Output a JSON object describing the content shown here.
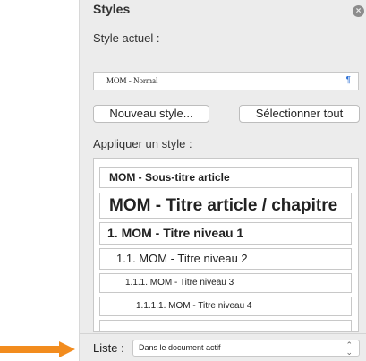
{
  "panel": {
    "title": "Styles",
    "close_icon": "close-icon",
    "current_label": "Style actuel :",
    "current_value": "MOM - Normal",
    "pilcrow": "¶",
    "new_style_button": "Nouveau style...",
    "select_all_button": "Sélectionner tout",
    "apply_label": "Appliquer un style :",
    "styles": [
      "MOM - Sous-titre article",
      "MOM - Titre article / chapitre",
      "1.  MOM - Titre niveau 1",
      "1.1.  MOM - Titre niveau 2",
      "1.1.1.  MOM - Titre niveau 3",
      "1.1.1.1.  MOM - Titre niveau 4"
    ],
    "list_label": "Liste :",
    "list_value": "Dans le document actif"
  },
  "colors": {
    "arrow": "#f28c1e",
    "panel_bg": "#ececec",
    "accent": "#2a6fd6"
  }
}
